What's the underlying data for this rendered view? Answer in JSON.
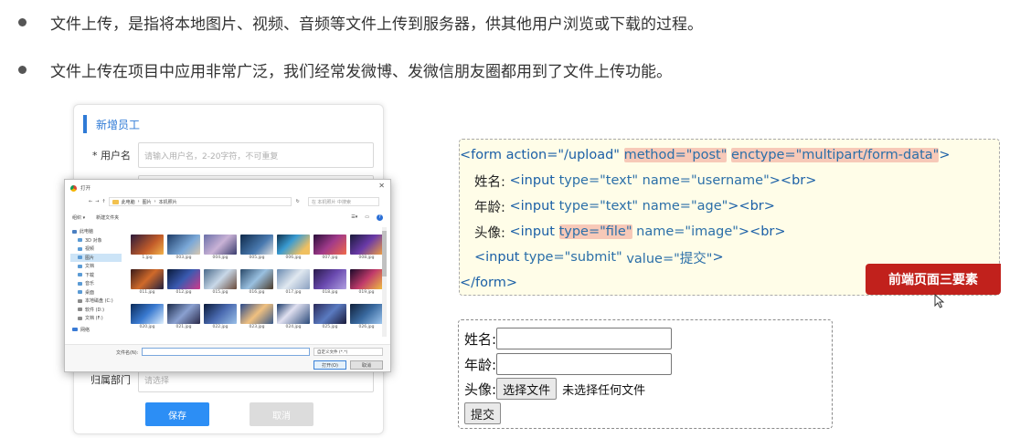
{
  "bullets": [
    "文件上传，是指将本地图片、视频、音频等文件上传到服务器，供其他用户浏览或下载的过程。",
    "文件上传在项目中应用非常广泛，我们经常发微博、发微信朋友圈都用到了文件上传功能。"
  ],
  "form_card": {
    "title": "新增员工",
    "username_label": "* 用户名",
    "username_placeholder": "请输入用户名，2-20字符，不可重复",
    "dept_label": "归属部门",
    "dept_placeholder": "请选择",
    "save_label": "保存",
    "cancel_label": "取消"
  },
  "file_dialog": {
    "title": "打开",
    "breadcrumb": [
      "此电脑",
      "图片",
      "本机照片"
    ],
    "search_placeholder": "在 本机照片 中搜索",
    "organize": "组织 ▾",
    "new_folder": "新建文件夹",
    "tree": [
      "此电脑",
      "3D 对象",
      "视频",
      "图片",
      "文档",
      "下载",
      "音乐",
      "桌面",
      "本地磁盘 (C:)",
      "软件 (D:)",
      "文档 (F:)",
      "网络"
    ],
    "files": [
      "1.jpg",
      "003.jpg",
      "004.jpg",
      "005.jpg",
      "006.jpg",
      "007.jpg",
      "008.jpg",
      "011.jpg",
      "012.jpg",
      "015.jpg",
      "016.jpg",
      "017.jpg",
      "018.jpg",
      "019.jpg",
      "020.jpg",
      "021.jpg",
      "022.jpg",
      "023.jpg",
      "024.jpg",
      "025.jpg",
      "026.jpg"
    ],
    "filename_label": "文件名(N):",
    "filetype": "自定义文件 (*.*)",
    "open_label": "打开(O)",
    "cancel_label": "取消"
  },
  "code": {
    "l1_open": "<form action=\"/upload\" ",
    "l1_method": "method=\"post\"",
    "l1_space": " ",
    "l1_enctype": "enctype=\"multipart/form-data\"",
    "l1_close": ">",
    "l2_label": "姓名: ",
    "l2_tag": "<input ",
    "l2_type": "type=\"text\"",
    "l2_name": " name=\"username\"",
    "l2_end": "><br>",
    "l3_label": "年龄: ",
    "l3_tag": "<input ",
    "l3_type": "type=\"text\"",
    "l3_name": " name=\"age\"",
    "l3_end": "><br>",
    "l4_label": "头像: ",
    "l4_tag": "<input ",
    "l4_type": "type=\"file\"",
    "l4_name": " name=\"image\"",
    "l4_end": "><br>",
    "l5_tag": "<input ",
    "l5_type": "type=\"submit\"",
    "l5_value": " value=\"提交\"",
    "l5_end": ">",
    "l6": "</form>"
  },
  "badge": "前端页面三要素",
  "result": {
    "name_label": "姓名:",
    "age_label": "年龄:",
    "avatar_label": "头像:",
    "choose_file": "选择文件",
    "no_file": "未选择任何文件",
    "submit": "提交"
  },
  "colors": {
    "accent_blue": "#2c8ef5",
    "badge_red": "#c1211c",
    "code_bg": "#fffde8",
    "highlight": "#f7c9b8"
  }
}
